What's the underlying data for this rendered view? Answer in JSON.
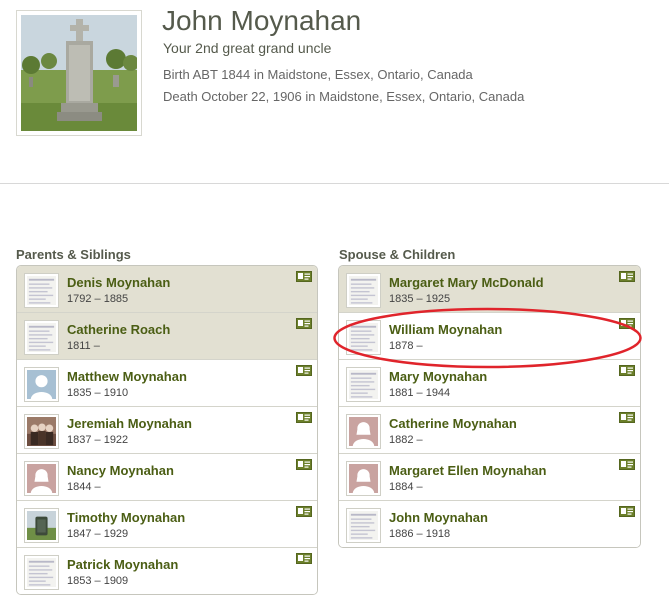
{
  "person": {
    "name": "John Moynahan",
    "relationship": "Your 2nd great grand uncle",
    "birth": "Birth ABT 1844 in Maidstone, Essex, Ontario, Canada",
    "death": "Death October 22, 1906 in Maidstone, Essex, Ontario, Canada"
  },
  "sections": {
    "parents_title": "Parents & Siblings",
    "spouse_title": "Spouse & Children"
  },
  "parents_siblings": [
    {
      "name": "Denis Moynahan",
      "dates": "1792 – 1885",
      "thumb": "document-thumbnail"
    },
    {
      "name": "Catherine Roach",
      "dates": "1811 –",
      "thumb": "document-thumbnail"
    },
    {
      "name": "Matthew Moynahan",
      "dates": "1835 – 1910",
      "thumb": "male-silhouette"
    },
    {
      "name": "Jeremiah Moynahan",
      "dates": "1837 – 1922",
      "thumb": "family-photo"
    },
    {
      "name": "Nancy Moynahan",
      "dates": "1844 –",
      "thumb": "female-silhouette"
    },
    {
      "name": "Timothy Moynahan",
      "dates": "1847 – 1929",
      "thumb": "gravestone-photo"
    },
    {
      "name": "Patrick Moynahan",
      "dates": "1853 – 1909",
      "thumb": "document-thumbnail"
    }
  ],
  "spouse_children": [
    {
      "name": "Margaret Mary McDonald",
      "dates": "1835 – 1925",
      "thumb": "document-thumbnail"
    },
    {
      "name": "William Moynahan",
      "dates": "1878 –",
      "thumb": "document-thumbnail"
    },
    {
      "name": "Mary Moynahan",
      "dates": "1881 – 1944",
      "thumb": "document-thumbnail"
    },
    {
      "name": "Catherine Moynahan",
      "dates": "1882 –",
      "thumb": "female-silhouette"
    },
    {
      "name": "Margaret Ellen Moynahan",
      "dates": "1884 –",
      "thumb": "female-silhouette"
    },
    {
      "name": "John Moynahan",
      "dates": "1886 – 1918",
      "thumb": "document-thumbnail"
    }
  ],
  "colors": {
    "name_green": "#4b5e14",
    "parent_row_bg": "#e2e0d2",
    "highlight_ring": "#e0242b",
    "card_icon": "#6b7f2a"
  }
}
